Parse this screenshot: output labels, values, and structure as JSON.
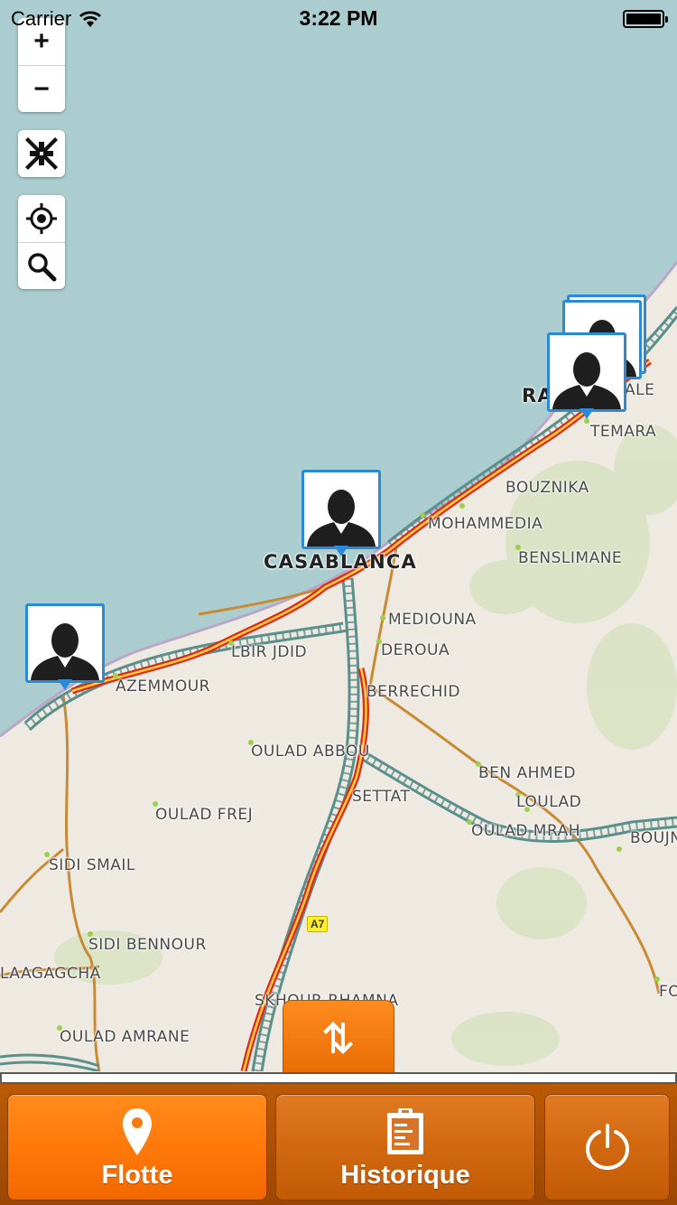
{
  "status_bar": {
    "carrier": "Carrier",
    "time": "3:22 PM",
    "battery_level": 1.0
  },
  "map": {
    "zoom_controls": {
      "zoom_in": "+",
      "zoom_out": "−"
    },
    "icons": [
      "zoom-in-icon",
      "zoom-out-icon",
      "collapse-icon",
      "locate-icon",
      "search-icon"
    ],
    "cities": [
      {
        "name": "CASABLANCA",
        "major": true
      },
      {
        "name": "RA"
      },
      {
        "name": "ALE"
      },
      {
        "name": "TEMARA"
      },
      {
        "name": "BOUZNIKA"
      },
      {
        "name": "MOHAMMEDIA"
      },
      {
        "name": "BENSLIMANE"
      },
      {
        "name": "MEDIOUNA"
      },
      {
        "name": "DEROUA"
      },
      {
        "name": "BERRECHID"
      },
      {
        "name": "LBIR JDID"
      },
      {
        "name": "AZEMMOUR"
      },
      {
        "name": "OULAD ABBOU"
      },
      {
        "name": "BEN AHMED"
      },
      {
        "name": "LOULAD"
      },
      {
        "name": "SETTAT"
      },
      {
        "name": "OULAD MRAH"
      },
      {
        "name": "BOUJN"
      },
      {
        "name": "OULAD FREJ"
      },
      {
        "name": "SIDI SMAIL"
      },
      {
        "name": "SIDI BENNOUR"
      },
      {
        "name": "LAAGAGCHA"
      },
      {
        "name": "SKHOUR RHAMNA"
      },
      {
        "name": "OULAD AMRANE"
      },
      {
        "name": "FO"
      }
    ],
    "road_sign": "A7",
    "markers": [
      "driver-azemmour",
      "driver-casablanca",
      "driver-rabat",
      "driver-rabat-stack"
    ],
    "colors": {
      "sea": "#abcdcf",
      "land": "#eeeae2",
      "motorway": "#e3261b",
      "railway": "#5a8f8c",
      "route": "#c98a34"
    }
  },
  "toggle_icon": "swap-vertical-icon",
  "tabs": [
    {
      "label": "Flotte",
      "icon": "map-pin-icon",
      "active": true
    },
    {
      "label": "Historique",
      "icon": "clipboard-icon",
      "active": false
    },
    {
      "label": "",
      "icon": "power-icon",
      "active": false
    }
  ],
  "accent_color": "#ff7a0b"
}
